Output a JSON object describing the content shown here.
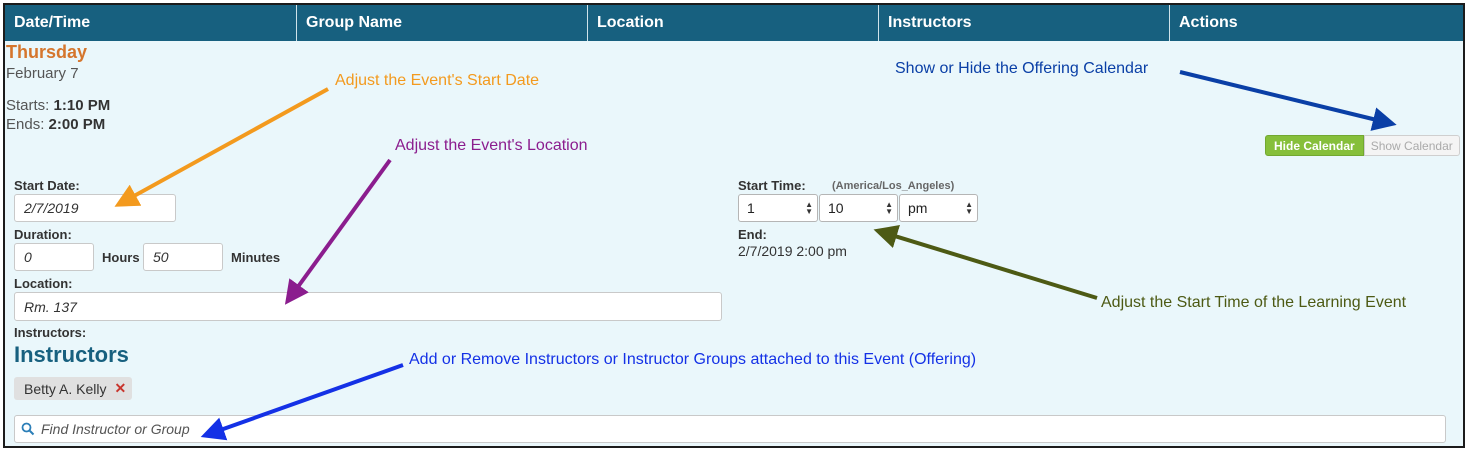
{
  "table_header": {
    "col_datetime": "Date/Time",
    "col_group": "Group Name",
    "col_location": "Location",
    "col_instructors": "Instructors",
    "col_actions": "Actions"
  },
  "event": {
    "day": "Thursday",
    "date": "February 7",
    "starts_label": "Starts:",
    "starts_value": "1:10 PM",
    "ends_label": "Ends:",
    "ends_value": "2:00 PM"
  },
  "calendar_toggle": {
    "hide_label": "Hide Calendar",
    "show_label": "Show Calendar"
  },
  "form": {
    "start_date_label": "Start Date:",
    "start_date_value": "2/7/2019",
    "duration_label": "Duration:",
    "hours_value": "0",
    "hours_label": "Hours",
    "minutes_value": "50",
    "minutes_label": "Minutes",
    "location_label": "Location:",
    "location_value": "Rm. 137",
    "instructors_label": "Instructors:",
    "start_time_label": "Start Time:",
    "timezone": "(America/Los_Angeles)",
    "hour_select": "1",
    "minute_select": "10",
    "ampm_select": "pm",
    "end_label": "End:",
    "end_value": "2/7/2019 2:00 pm"
  },
  "instructors": {
    "heading": "Instructors",
    "items": [
      "Betty A. Kelly"
    ],
    "search_placeholder": "Find Instructor or Group"
  },
  "annotations": {
    "start_date": "Adjust the Event's Start Date",
    "location": "Adjust the Event's Location",
    "calendar": "Show or Hide the Offering Calendar",
    "start_time": "Adjust the Start Time of the Learning Event",
    "instructors": "Add or Remove Instructors or Instructor Groups attached to this Event (Offering)"
  },
  "colors": {
    "header_bg": "#17607f",
    "panel_bg": "#eaf7fb",
    "day_color": "#d5762d",
    "hide_button": "#86bf3a",
    "ann_start_date": "#f39a1e",
    "ann_location": "#8b1d8e",
    "ann_calendar": "#0a3fa6",
    "ann_start_time": "#4d5a14",
    "ann_instructors": "#1431e6"
  },
  "icons": {
    "search": "search-icon",
    "remove": "remove-icon",
    "select_arrows": "select-arrows-icon"
  }
}
